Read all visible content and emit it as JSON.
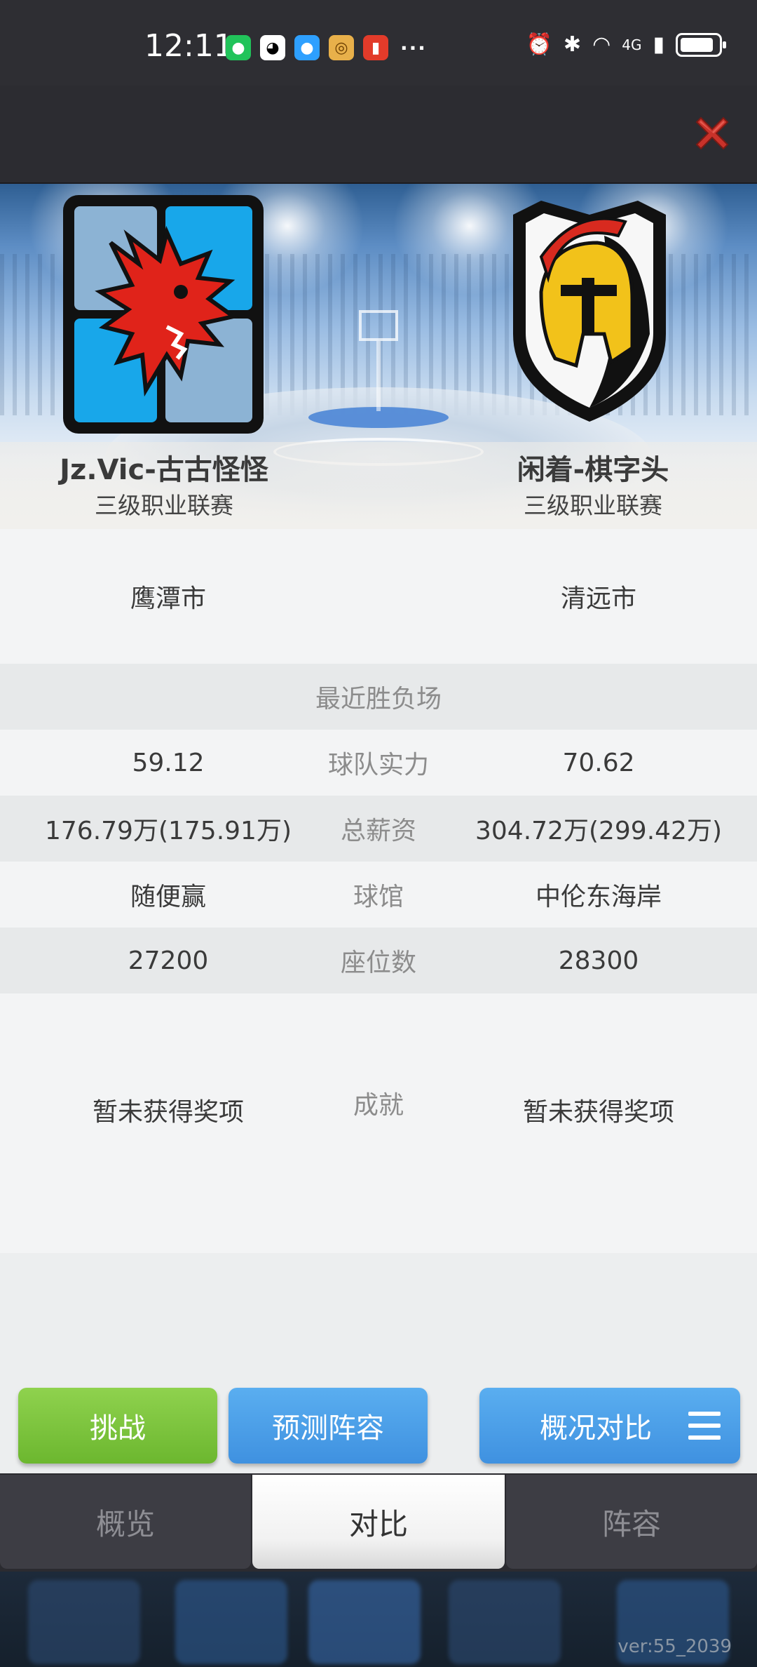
{
  "status_bar": {
    "time": "12:11",
    "notifications": [
      "wechat-icon",
      "qq-icon",
      "message-icon",
      "box-icon",
      "ting-icon"
    ],
    "more": "···",
    "network": "4G"
  },
  "header": {
    "close_icon": "close-icon"
  },
  "teams": {
    "left": {
      "name": "Jz.Vic-古古怪怪",
      "league": "三级职业联赛",
      "city": "鹰潭市",
      "strength": "59.12",
      "salary": "176.79万(175.91万)",
      "arena": "随便赢",
      "seats": "27200",
      "achievement": "暂未获得奖项"
    },
    "right": {
      "name": "闲着-棋字头",
      "league": "三级职业联赛",
      "city": "清远市",
      "strength": "70.62",
      "salary": "304.72万(299.42万)",
      "arena": "中伦东海岸",
      "seats": "28300",
      "achievement": "暂未获得奖项"
    }
  },
  "labels": {
    "recent": "最近胜负场",
    "strength": "球队实力",
    "salary": "总薪资",
    "arena": "球馆",
    "seats": "座位数",
    "achievement": "成就"
  },
  "buttons": {
    "challenge": "挑战",
    "predict": "预测阵容",
    "overview": "概况对比"
  },
  "tabs": [
    "概览",
    "对比",
    "阵容"
  ],
  "active_tab": "对比",
  "version": "ver:55_2039",
  "colors": {
    "challenge_green": "#6cb72f",
    "action_blue": "#3f91e0",
    "close_red": "#d9352b"
  }
}
